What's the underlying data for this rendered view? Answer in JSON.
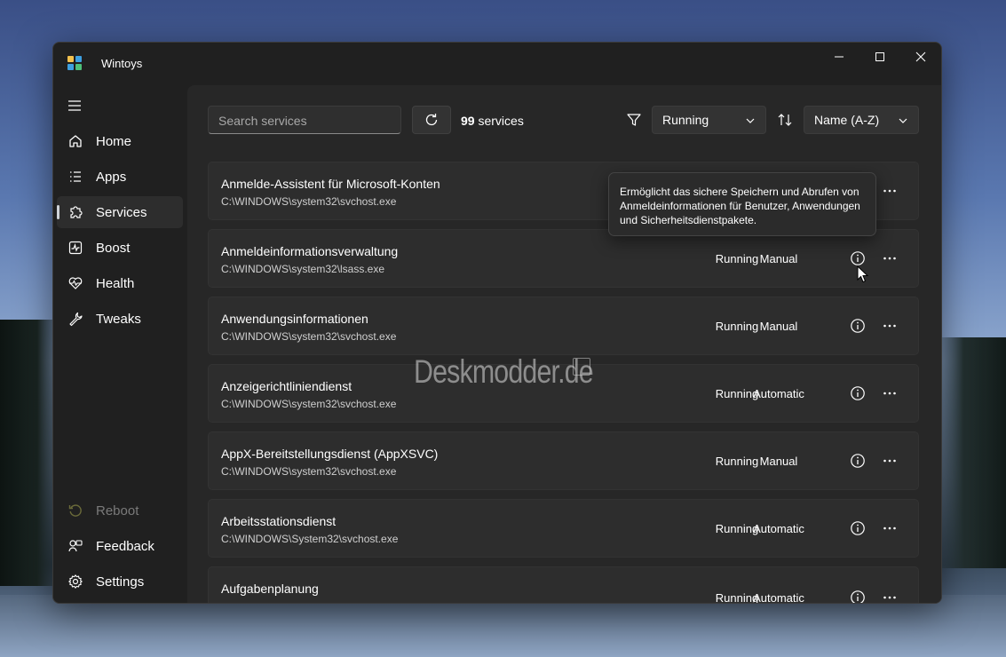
{
  "app": {
    "title": "Wintoys"
  },
  "window_controls": [
    "minimize-icon",
    "maximize-icon",
    "close-icon"
  ],
  "sidebar": {
    "items": [
      {
        "label": "Home",
        "icon": "home-icon"
      },
      {
        "label": "Apps",
        "icon": "apps-list-icon"
      },
      {
        "label": "Services",
        "icon": "puzzle-icon",
        "active": true
      },
      {
        "label": "Boost",
        "icon": "pulse-icon"
      },
      {
        "label": "Health",
        "icon": "heart-pulse-icon"
      },
      {
        "label": "Tweaks",
        "icon": "wrench-icon"
      }
    ],
    "footer": [
      {
        "label": "Reboot",
        "icon": "restart-icon",
        "disabled": true
      },
      {
        "label": "Feedback",
        "icon": "feedback-icon"
      },
      {
        "label": "Settings",
        "icon": "gear-icon"
      }
    ]
  },
  "toolbar": {
    "search_placeholder": "Search services",
    "count_number": "99",
    "count_label": " services",
    "filter_value": "Running",
    "sort_value": "Name (A-Z)"
  },
  "services": [
    {
      "name": "Anmelde-Assistent für Microsoft-Konten",
      "path": "C:\\WINDOWS\\system32\\svchost.exe",
      "status": "",
      "startup": ""
    },
    {
      "name": "Anmeldeinformationsverwaltung",
      "path": "C:\\WINDOWS\\system32\\lsass.exe",
      "status": "Running",
      "startup": "Manual"
    },
    {
      "name": "Anwendungsinformationen",
      "path": "C:\\WINDOWS\\system32\\svchost.exe",
      "status": "Running",
      "startup": "Manual"
    },
    {
      "name": "Anzeigerichtliniendienst",
      "path": "C:\\WINDOWS\\system32\\svchost.exe",
      "status": "Running",
      "startup": "Automatic"
    },
    {
      "name": "AppX-Bereitstellungsdienst (AppXSVC)",
      "path": "C:\\WINDOWS\\system32\\svchost.exe",
      "status": "Running",
      "startup": "Manual"
    },
    {
      "name": "Arbeitsstationsdienst",
      "path": "C:\\WINDOWS\\System32\\svchost.exe",
      "status": "Running",
      "startup": "Automatic"
    },
    {
      "name": "Aufgabenplanung",
      "path": "",
      "status": "Running",
      "startup": "Automatic"
    }
  ],
  "tooltip": {
    "text": "Ermöglicht das sichere Speichern und Abrufen von Anmeldeinformationen für Benutzer, Anwendungen und Sicherheitsdienstpakete."
  },
  "watermark": {
    "text": "Deskmodder.de"
  }
}
